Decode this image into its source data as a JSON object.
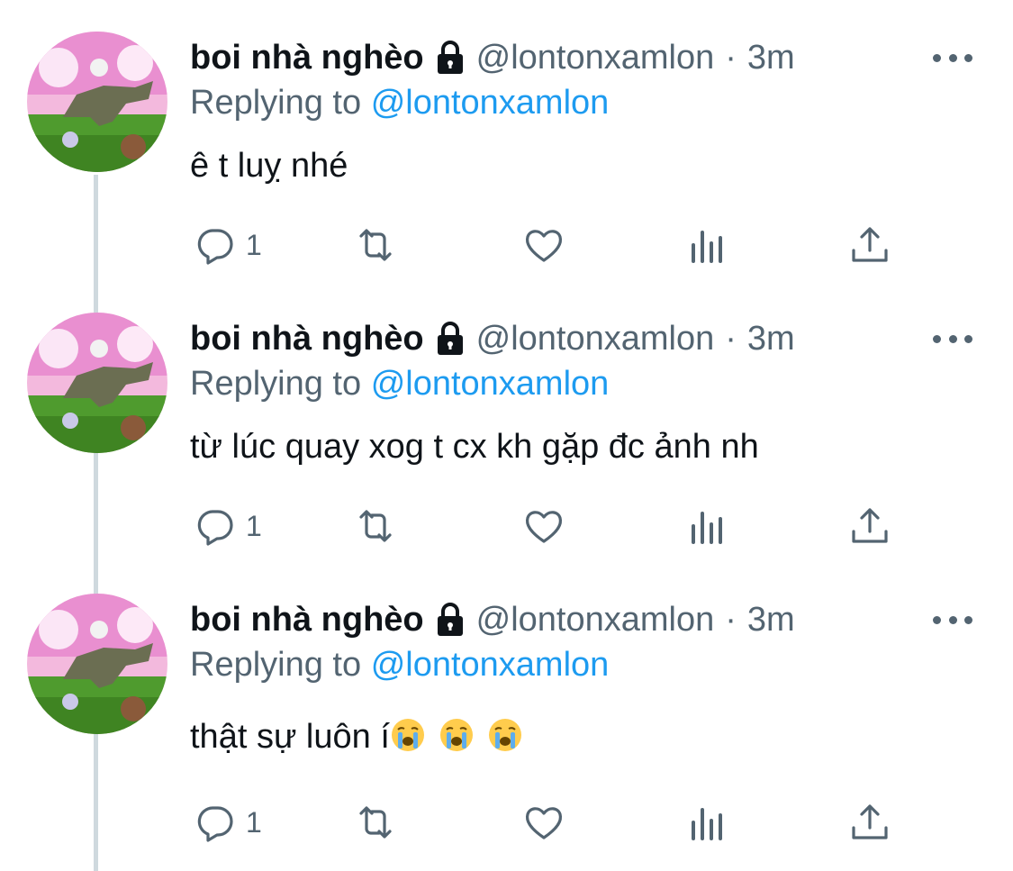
{
  "colors": {
    "text": "#0f1419",
    "secondary": "#536471",
    "accent": "#1d9bf0",
    "thread_line": "#cfd9de"
  },
  "tweets": [
    {
      "display_name": "boi nhà nghèo",
      "handle": "@lontonxamlon",
      "separator": "·",
      "time": "3m",
      "replying_prefix": "Replying to",
      "replying_to": "@lontonxamlon",
      "text": "ê t luỵ nhé",
      "emoji": [],
      "reply_count": "1",
      "icons": [
        "lock-icon",
        "more-icon",
        "reply-icon",
        "retweet-icon",
        "like-icon",
        "views-icon",
        "share-icon"
      ]
    },
    {
      "display_name": "boi nhà nghèo",
      "handle": "@lontonxamlon",
      "separator": "·",
      "time": "3m",
      "replying_prefix": "Replying to",
      "replying_to": "@lontonxamlon",
      "text": "từ lúc quay xog t cx kh gặp đc ảnh nh",
      "emoji": [],
      "reply_count": "1",
      "icons": [
        "lock-icon",
        "more-icon",
        "reply-icon",
        "retweet-icon",
        "like-icon",
        "views-icon",
        "share-icon"
      ]
    },
    {
      "display_name": "boi nhà nghèo",
      "handle": "@lontonxamlon",
      "separator": "·",
      "time": "3m",
      "replying_prefix": "Replying to",
      "replying_to": "@lontonxamlon",
      "text": "thật sự luôn í",
      "emoji": [
        "loudly-crying-face",
        "loudly-crying-face",
        "loudly-crying-face"
      ],
      "reply_count": "1",
      "icons": [
        "lock-icon",
        "more-icon",
        "reply-icon",
        "retweet-icon",
        "like-icon",
        "views-icon",
        "share-icon"
      ]
    }
  ]
}
